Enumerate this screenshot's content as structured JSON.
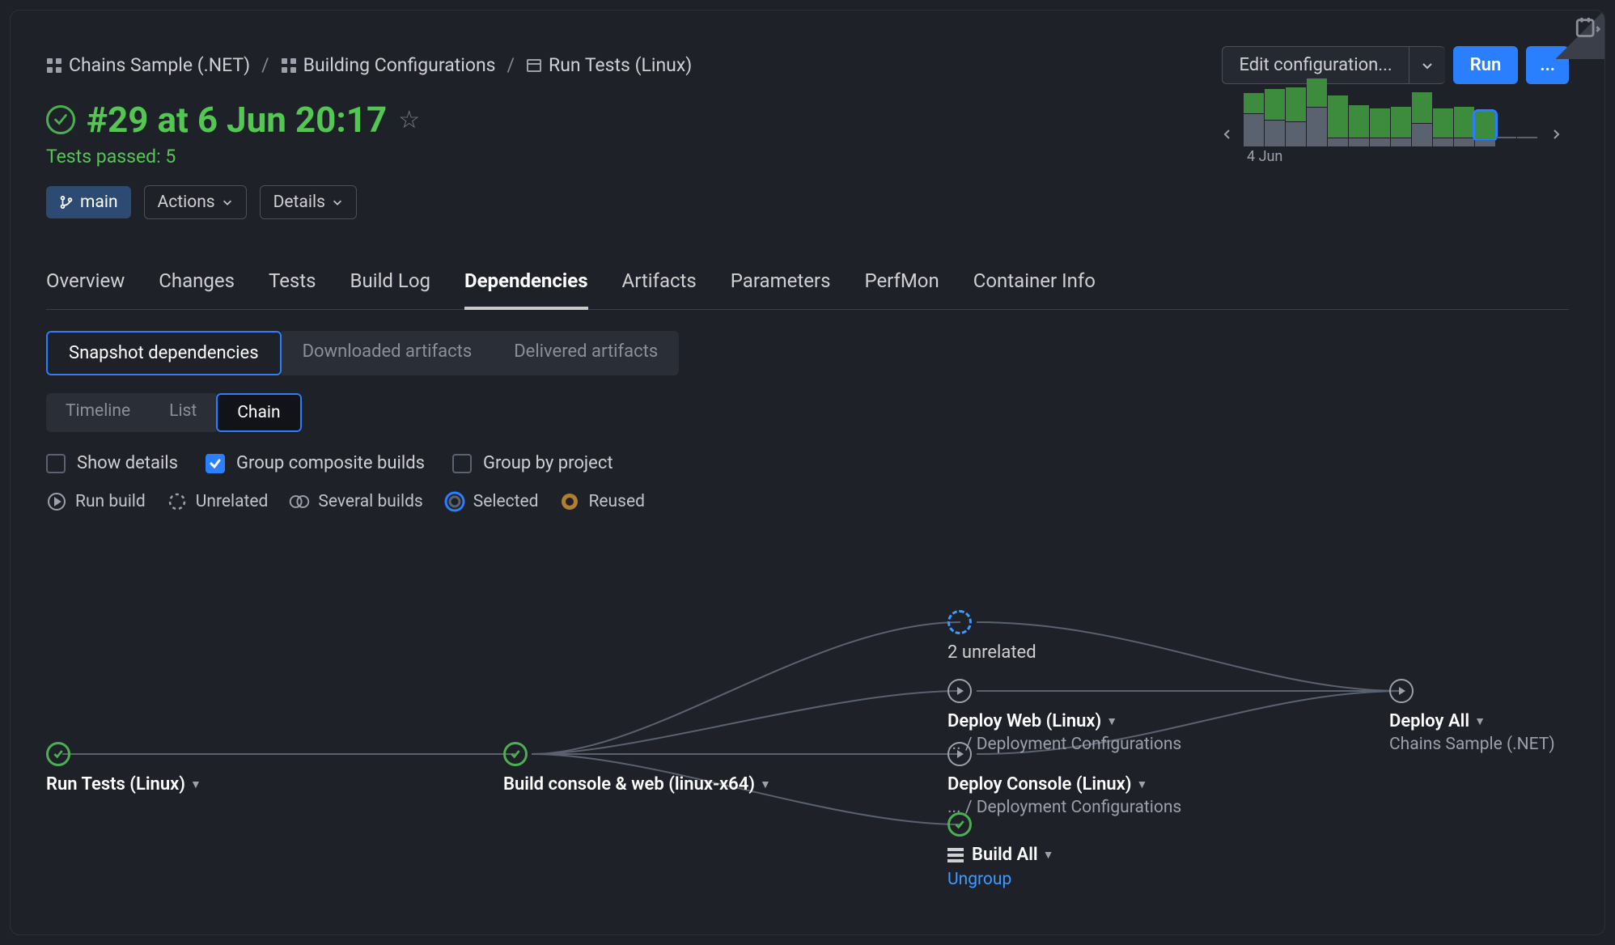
{
  "breadcrumbs": [
    {
      "label": "Chains Sample (.NET)",
      "icon": "project"
    },
    {
      "label": "Building Configurations",
      "icon": "project"
    },
    {
      "label": "Run Tests (Linux)",
      "icon": "config"
    }
  ],
  "header_buttons": {
    "edit": "Edit configuration...",
    "run": "Run",
    "more": "..."
  },
  "build": {
    "status_icon": "success",
    "title": "#29 at 6 Jun 20:17",
    "subtitle": "Tests passed: 5",
    "branch": "main"
  },
  "actions": {
    "actions_label": "Actions",
    "details_label": "Details"
  },
  "tabs": [
    "Overview",
    "Changes",
    "Tests",
    "Build Log",
    "Dependencies",
    "Artifacts",
    "Parameters",
    "PerfMon",
    "Container Info"
  ],
  "active_tab": "Dependencies",
  "subtabs": {
    "items": [
      "Snapshot dependencies",
      "Downloaded artifacts",
      "Delivered artifacts"
    ],
    "active": "Snapshot dependencies"
  },
  "viewtabs": {
    "items": [
      "Timeline",
      "List",
      "Chain"
    ],
    "active": "Chain"
  },
  "options": {
    "show_details": {
      "label": "Show details",
      "checked": false
    },
    "group_composite": {
      "label": "Group composite builds",
      "checked": true
    },
    "group_project": {
      "label": "Group by project",
      "checked": false
    }
  },
  "legend": [
    {
      "key": "run",
      "label": "Run build"
    },
    {
      "key": "unrelated",
      "label": "Unrelated"
    },
    {
      "key": "several",
      "label": "Several builds"
    },
    {
      "key": "selected",
      "label": "Selected"
    },
    {
      "key": "reused",
      "label": "Reused"
    }
  ],
  "chain": {
    "unrelated_label": "2 unrelated",
    "n1": {
      "title": "Run Tests (Linux)"
    },
    "n2": {
      "title": "Build console & web (linux-x64)"
    },
    "n3": {
      "title": "Deploy Web (Linux)",
      "sub": "... / Deployment Configurations"
    },
    "n4": {
      "title": "Deploy Console (Linux)",
      "sub": "... / Deployment Configurations"
    },
    "n5": {
      "title": "Build All",
      "link": "Ungroup"
    },
    "n6": {
      "title": "Deploy All",
      "sub": "Chains Sample (.NET)"
    }
  },
  "chart_data": {
    "type": "bar",
    "date_label": "4 Jun",
    "selected_index": 11,
    "bars": [
      {
        "g": 25,
        "b": 40
      },
      {
        "g": 38,
        "b": 32
      },
      {
        "g": 42,
        "b": 30
      },
      {
        "g": 35,
        "b": 48
      },
      {
        "g": 52,
        "b": 10
      },
      {
        "g": 40,
        "b": 10
      },
      {
        "g": 36,
        "b": 10
      },
      {
        "g": 38,
        "b": 10
      },
      {
        "g": 38,
        "b": 28
      },
      {
        "g": 36,
        "b": 10
      },
      {
        "g": 38,
        "b": 10
      },
      {
        "g": 34,
        "b": 8
      },
      {
        "g": 0,
        "b": 0,
        "dash": true
      },
      {
        "g": 0,
        "b": 0,
        "dash": true
      }
    ]
  }
}
